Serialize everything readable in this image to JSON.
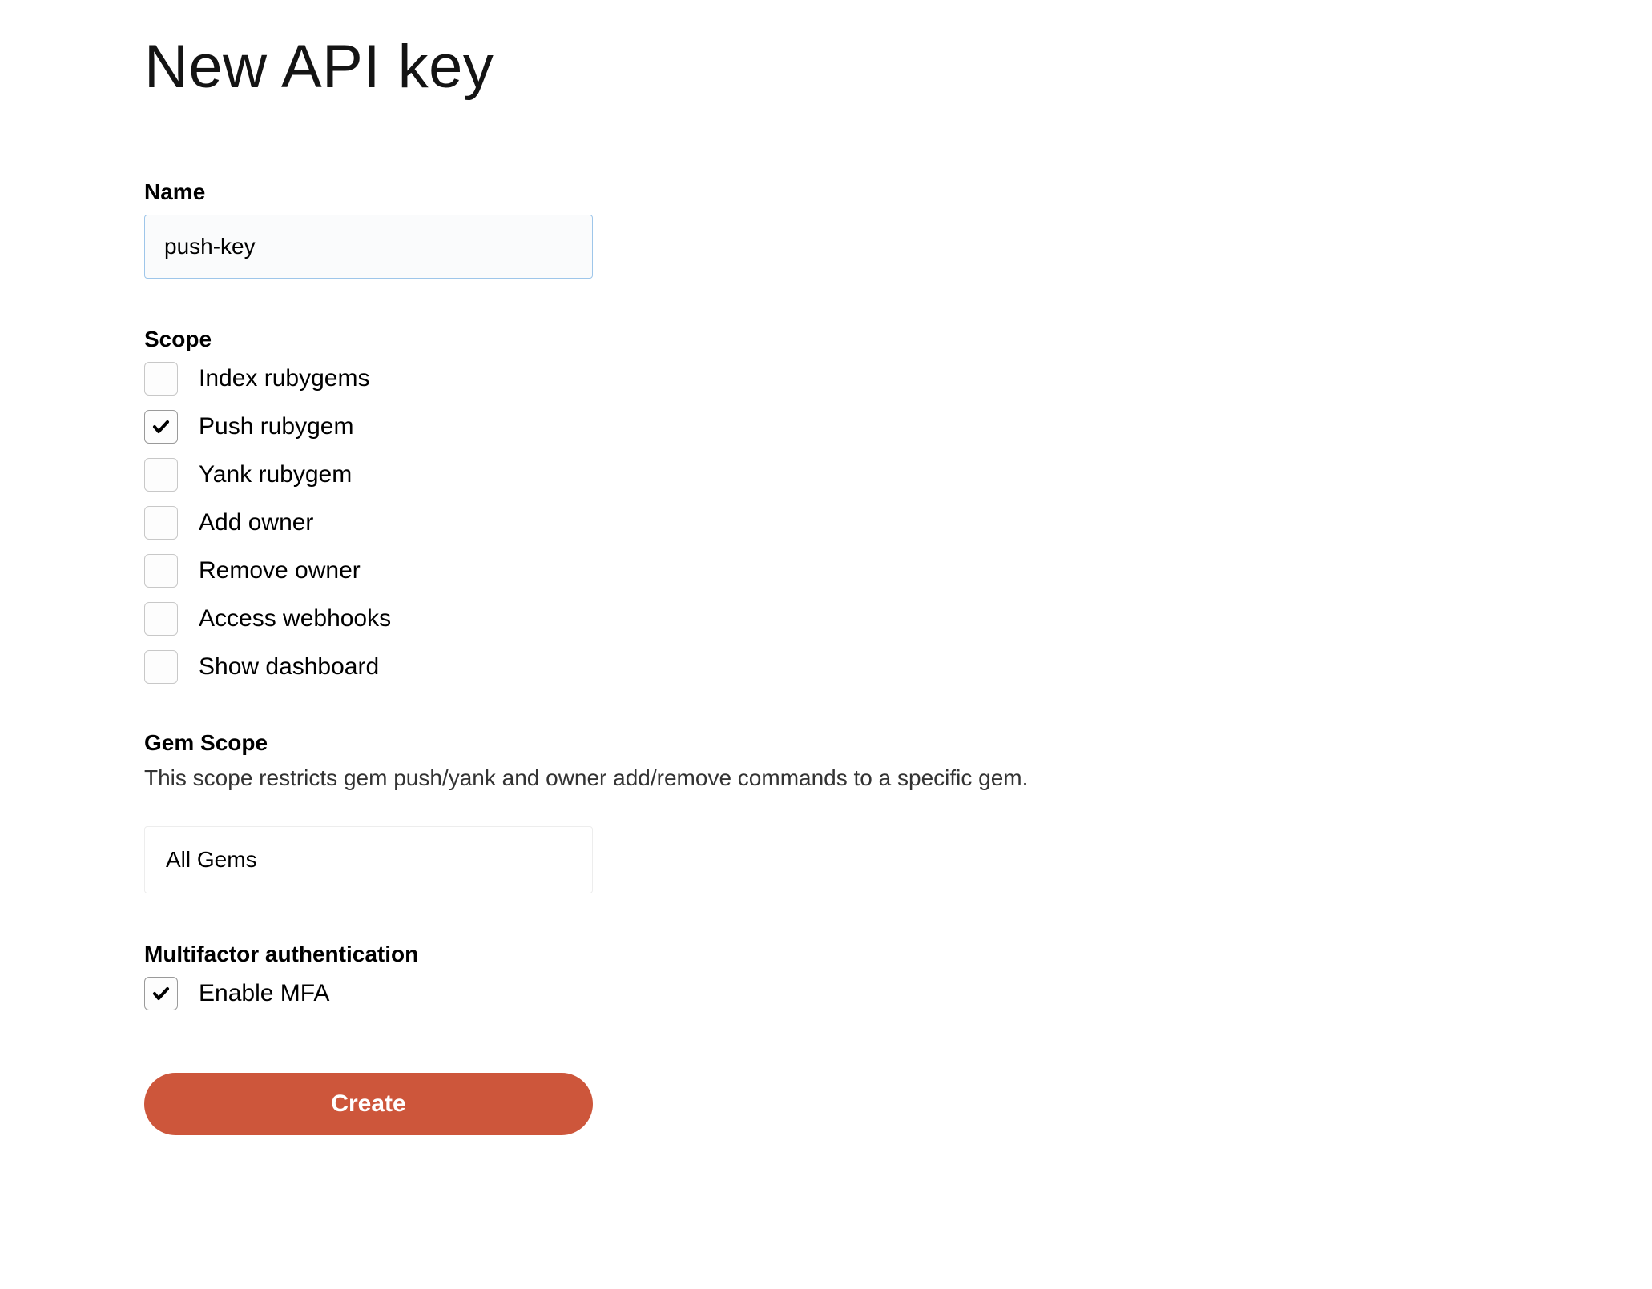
{
  "page": {
    "title": "New API key"
  },
  "form": {
    "name_label": "Name",
    "name_value": "push-key",
    "scope_label": "Scope",
    "scopes": [
      {
        "label": "Index rubygems",
        "checked": false
      },
      {
        "label": "Push rubygem",
        "checked": true
      },
      {
        "label": "Yank rubygem",
        "checked": false
      },
      {
        "label": "Add owner",
        "checked": false
      },
      {
        "label": "Remove owner",
        "checked": false
      },
      {
        "label": "Access webhooks",
        "checked": false
      },
      {
        "label": "Show dashboard",
        "checked": false
      }
    ],
    "gem_scope_label": "Gem Scope",
    "gem_scope_help": "This scope restricts gem push/yank and owner add/remove commands to a specific gem.",
    "gem_scope_value": "All Gems",
    "mfa_label": "Multifactor authentication",
    "mfa_checkbox_label": "Enable MFA",
    "mfa_checked": true,
    "submit_label": "Create"
  }
}
